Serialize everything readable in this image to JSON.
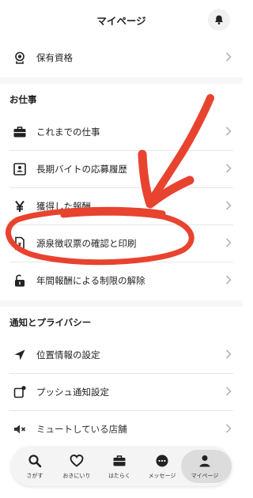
{
  "header": {
    "title": "マイページ"
  },
  "items_top": [
    {
      "label": "保有資格",
      "icon": "certificate-icon"
    }
  ],
  "sections": {
    "work": "お仕事",
    "notify": "通知とプライバシー"
  },
  "work_items": [
    {
      "label": "これまでの仕事",
      "icon": "briefcase-icon"
    },
    {
      "label": "長期バイトの応募履歴",
      "icon": "id-card-icon"
    },
    {
      "label": "獲得した報酬",
      "icon": "yen-icon"
    },
    {
      "label": "源泉徴収票の確認と印刷",
      "icon": "document-icon"
    },
    {
      "label": "年間報酬による制限の解除",
      "icon": "unlock-icon"
    }
  ],
  "notify_items": [
    {
      "label": "位置情報の設定",
      "icon": "location-arrow-icon"
    },
    {
      "label": "プッシュ通知設定",
      "icon": "push-notification-icon"
    },
    {
      "label": "ミュートしている店舗",
      "icon": "mute-speaker-icon"
    }
  ],
  "tabbar": [
    {
      "label": "さがす",
      "icon": "search-icon"
    },
    {
      "label": "おきにいり",
      "icon": "heart-icon"
    },
    {
      "label": "はたらく",
      "icon": "briefcase-icon"
    },
    {
      "label": "メッセージ",
      "icon": "message-icon"
    },
    {
      "label": "マイページ",
      "icon": "person-icon",
      "active": true
    }
  ],
  "colors": {
    "annotation": "#e8432f",
    "text": "#222222",
    "chevron": "#b5b5b5"
  }
}
